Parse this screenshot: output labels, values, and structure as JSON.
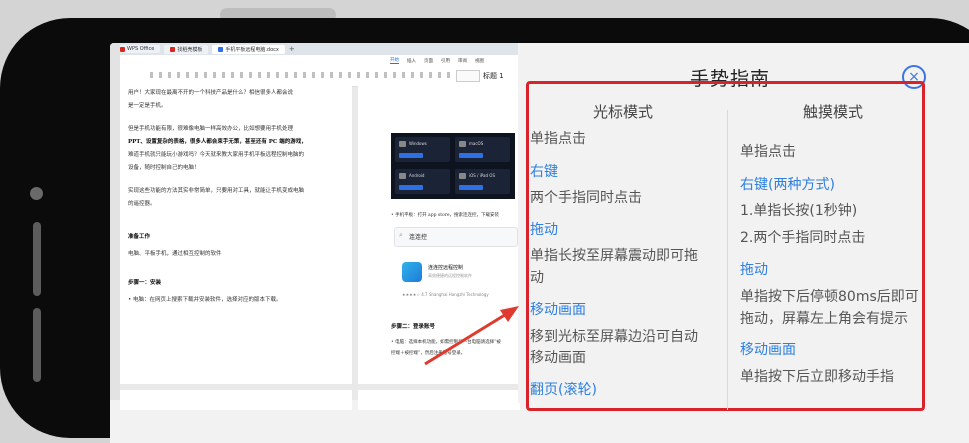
{
  "device": {
    "frame_color": "#0b0b0b"
  },
  "document": {
    "tabs": [
      {
        "label": "WPS Office",
        "color": "#d6281f",
        "active": false
      },
      {
        "label": "找稻壳模板",
        "color": "#d6281f",
        "active": false
      },
      {
        "label": "手机平板远程电脑.docx",
        "color": "#2f6fe4",
        "active": true
      }
    ],
    "menu": [
      "开始",
      "插入",
      "页面",
      "引用",
      "审阅",
      "视图"
    ],
    "toolbar": {
      "style_label": "标题 1"
    },
    "left_page_lines": [
      {
        "text": "用户！大家现在最离不开的一个科技产品是什么？相信很多人都会说",
        "bold": false
      },
      {
        "text": "是一定是手机。",
        "bold": false
      },
      {
        "text": "但是手机功能有限，很难像电脑一样高效办公，比如想要用手机处理",
        "bold": false
      },
      {
        "text": "PPT、设置复杂的表格，很多人都会束手无策，甚至还有 PC 端的游戏，",
        "bold": true
      },
      {
        "text": "难道手机就只能玩小游戏吗？今天就来教大家用手机平板远程控制电脑的",
        "bold": false
      },
      {
        "text": "设备，随时控制自己的电脑！",
        "bold": false
      },
      {
        "text": "实现这些功能的方法其实非常简单，只要用对工具，就能让手机变成电脑",
        "bold": false
      },
      {
        "text": "的遥控器。",
        "bold": false
      },
      {
        "text": "准备工作",
        "bold": true
      },
      {
        "text": "电脑、平板手机，通过相互控制的软件",
        "bold": false
      },
      {
        "text": "步骤一：安装",
        "bold": true
      },
      {
        "text": "• 电脑：在网页上搜索下载并安装软件，选择对应的版本下载。",
        "bold": false
      }
    ],
    "right_page": {
      "downloads": [
        {
          "label": "Windows"
        },
        {
          "label": "macOS"
        },
        {
          "label": "Android"
        },
        {
          "label": "iOS / iPad OS"
        }
      ],
      "note": "• 手机平板：打开 app store，搜索连连控，下载安装",
      "search_text": "连连控",
      "app_name": "连连控远程控制",
      "app_sub": "高效便捷的远程控制软件",
      "app_meta": "★★★★☆ 4.7    Shanghai Hangzhi Technology",
      "step2": "步骤二：登录账号",
      "step2_line1": "• 电脑：选择本机功能，如需控制另一台电脑请选择“被",
      "step2_line2": "控端＋被控端”，然后注册账号登录。"
    }
  },
  "guide": {
    "title": "手势指南",
    "close_label": "×",
    "highlight_color": "#d8232a",
    "accent_color": "#2d7fe0",
    "cursor_mode": {
      "title": "光标模式",
      "items": [
        {
          "kind": "text",
          "text": "单指点击"
        },
        {
          "kind": "head",
          "text": "右键"
        },
        {
          "kind": "text",
          "text": "两个手指同时点击"
        },
        {
          "kind": "head",
          "text": "拖动"
        },
        {
          "kind": "text",
          "text": "单指长按至屏幕震动即可拖"
        },
        {
          "kind": "text",
          "text": "动"
        },
        {
          "kind": "head",
          "text": "移动画面"
        },
        {
          "kind": "text",
          "text": "移到光标至屏幕边沿可自动"
        },
        {
          "kind": "text",
          "text": "移动画面"
        },
        {
          "kind": "head",
          "text": "翻页(滚轮)"
        }
      ]
    },
    "touch_mode": {
      "title": "触摸模式",
      "items": [
        {
          "kind": "text",
          "text": "单指点击"
        },
        {
          "kind": "head",
          "text": "右键(两种方式)"
        },
        {
          "kind": "text",
          "text": "1.单指长按(1秒钟)"
        },
        {
          "kind": "text",
          "text": "2.两个手指同时点击"
        },
        {
          "kind": "head",
          "text": "拖动"
        },
        {
          "kind": "text",
          "text": "单指按下后停顿80ms后即可"
        },
        {
          "kind": "text",
          "text": "拖动，屏幕左上角会有提示"
        },
        {
          "kind": "head",
          "text": "移动画面"
        },
        {
          "kind": "text",
          "text": "单指按下后立即移动手指"
        }
      ]
    }
  }
}
